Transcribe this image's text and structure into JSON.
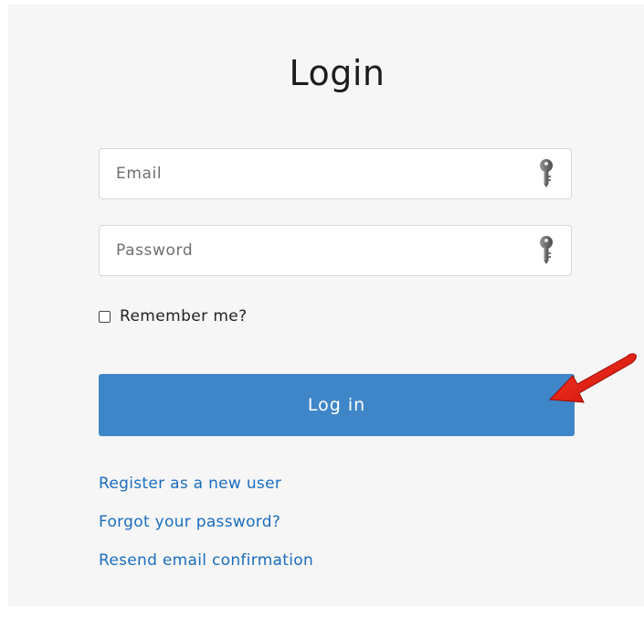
{
  "page": {
    "title": "Login"
  },
  "form": {
    "email": {
      "placeholder": "Email",
      "value": "",
      "icon": "key-icon"
    },
    "password": {
      "placeholder": "Password",
      "value": "",
      "icon": "key-icon"
    },
    "remember": {
      "label": "Remember me?",
      "checked": false
    },
    "submit_label": "Log in"
  },
  "links": {
    "register": "Register as a new user",
    "forgot": "Forgot your password?",
    "resend": "Resend email confirmation"
  },
  "annotation": {
    "icon": "red-arrow-icon"
  },
  "colors": {
    "panel_background": "#f6f6f6",
    "button_primary": "#3f86c9",
    "link": "#1b6dbe",
    "annotation_arrow": "#e3170a"
  }
}
